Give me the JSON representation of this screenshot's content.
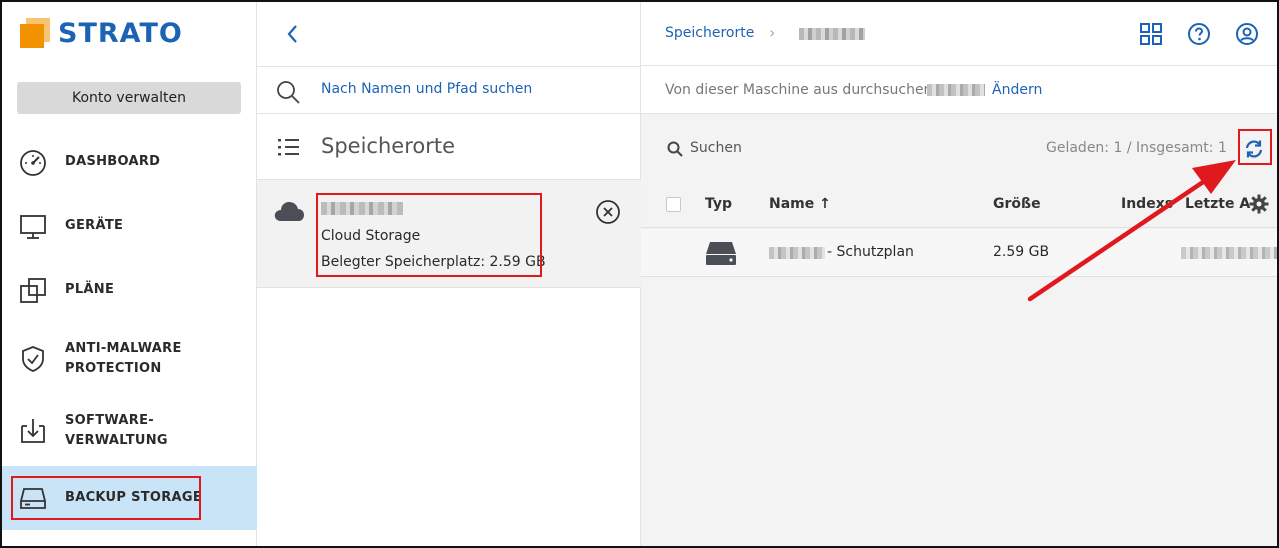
{
  "brand": {
    "name": "STRATO",
    "orange": "#f39200",
    "blue": "#1d63b5"
  },
  "sidebar": {
    "account_button": "Konto verwalten",
    "items": [
      {
        "label": "DASHBOARD",
        "icon": "speedometer-icon"
      },
      {
        "label": "GERÄTE",
        "icon": "monitor-icon"
      },
      {
        "label": "PLÄNE",
        "icon": "plans-icon"
      },
      {
        "label": "ANTI-MALWARE",
        "label2": "PROTECTION",
        "icon": "shield-icon"
      },
      {
        "label": "SOFTWARE-",
        "label2": "VERWALTUNG",
        "icon": "software-install-icon"
      },
      {
        "label": "BACKUP STORAGE",
        "icon": "hard-drive-icon",
        "active": true
      }
    ]
  },
  "middle": {
    "search_placeholder": "Nach Namen und Pfad suchen",
    "heading": "Speicherorte",
    "location": {
      "type": "Cloud Storage",
      "usage": "Belegter Speicherplatz: 2.59 GB"
    }
  },
  "right": {
    "breadcrumb_root": "Speicherorte",
    "breadcrumb_sep": "›",
    "subbar_text": "Von dieser Maschine aus durchsuchen:",
    "subbar_link": "Ändern",
    "search_label": "Suchen",
    "loaded_text": "Geladen: 1 / Insgesamt: 1",
    "columns": {
      "type": "Typ",
      "name": "Name ↑",
      "size": "Größe",
      "index": "Indexs",
      "last": "Letzte A"
    },
    "rows": [
      {
        "name_suffix": "- Schutzplan",
        "size": "2.59 GB",
        "icon": "hard-drive-icon"
      }
    ]
  },
  "annotation_color": "#e0191e"
}
